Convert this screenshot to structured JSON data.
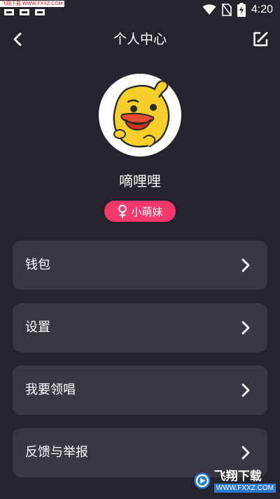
{
  "status_bar": {
    "watermark_text": "飞翔下载 WWW.FXXZ.COM",
    "time": "4:20"
  },
  "header": {
    "title": "个人中心",
    "back_icon": "chevron-left-icon",
    "edit_icon": "edit-icon"
  },
  "profile": {
    "username": "嘀哩哩",
    "badge_label": "小萌妹",
    "badge_color": "#f2386c",
    "avatar": "duck-avatar"
  },
  "menu": {
    "items": [
      {
        "label": "钱包"
      },
      {
        "label": "设置"
      },
      {
        "label": "我要领唱"
      },
      {
        "label": "反馈与举报"
      }
    ]
  },
  "watermark": {
    "brand": "飞翔下载",
    "url": "WWW.FXXZ.COM"
  },
  "colors": {
    "background": "#26232f",
    "card": "#3a3745",
    "accent": "#f2386c"
  }
}
